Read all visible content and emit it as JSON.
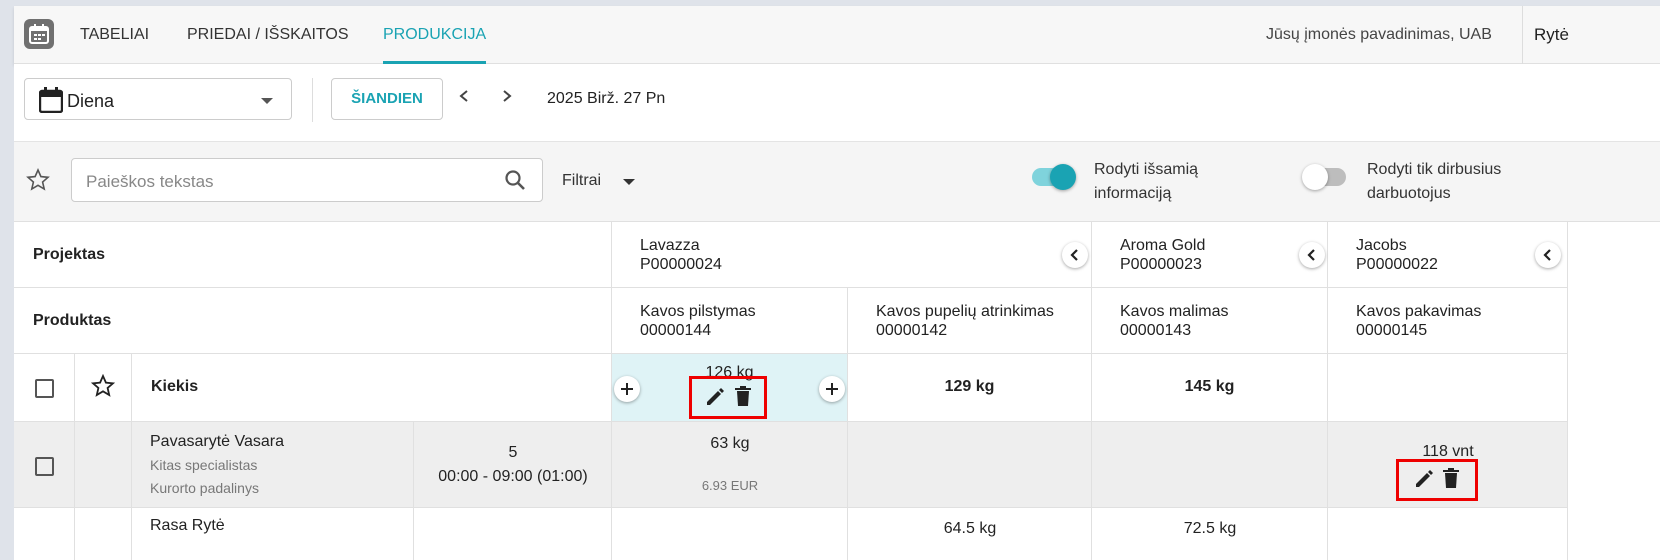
{
  "nav": {
    "tabs": [
      {
        "label": "TABELIAI"
      },
      {
        "label": "PRIEDAI / IŠSKAITOS"
      },
      {
        "label": "PRODUKCIJA"
      }
    ],
    "company": "Jūsų įmonės pavadinimas, UAB",
    "user": "Rytė"
  },
  "toolbar": {
    "period": "Diena",
    "today_label": "ŠIANDIEN",
    "date": "2025 Birž. 27 Pn"
  },
  "filters": {
    "search_placeholder": "Paieškos tekstas",
    "filter_label": "Filtrai",
    "toggle_detail": {
      "line1": "Rodyti išsamią",
      "line2": "informaciją",
      "on": true
    },
    "toggle_working": {
      "line1": "Rodyti tik dirbusius",
      "line2": "darbuotojus",
      "on": false
    }
  },
  "grid": {
    "project_header": "Projektas",
    "product_header": "Produktas",
    "quantity_label": "Kiekis",
    "projects": [
      {
        "name": "Lavazza",
        "code": "P00000024"
      },
      {
        "name": "Aroma Gold",
        "code": "P00000023"
      },
      {
        "name": "Jacobs",
        "code": "P00000022"
      }
    ],
    "products": [
      {
        "name": "Kavos pilstymas",
        "code": "00000144"
      },
      {
        "name": "Kavos pupelių atrinkimas",
        "code": "00000142"
      },
      {
        "name": "Kavos malimas",
        "code": "00000143"
      },
      {
        "name": "Kavos pakavimas",
        "code": "00000145"
      }
    ],
    "totals": [
      "126 kg",
      "129 kg",
      "145 kg",
      ""
    ],
    "rows": [
      {
        "name": "Pavasarytė Vasara",
        "role": "Kitas specialistas",
        "unit": "Kurorto padalinys",
        "count": "5",
        "time": "00:00 - 09:00 (01:00)",
        "cells": [
          "63 kg",
          "",
          "",
          "118 vnt"
        ],
        "price": "6.93 EUR"
      },
      {
        "name": "Rasa Rytė",
        "cells": [
          "",
          "64.5 kg",
          "72.5 kg",
          ""
        ]
      }
    ]
  }
}
